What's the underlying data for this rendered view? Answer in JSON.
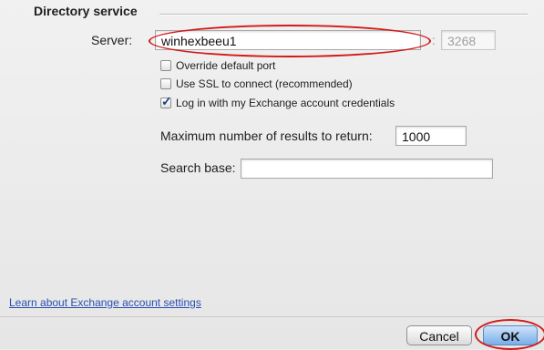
{
  "section": {
    "title": "Directory service"
  },
  "server": {
    "label": "Server:",
    "value": "winhexbeeu1",
    "port_value": "3268",
    "port_separator": ":"
  },
  "checkboxes": [
    {
      "label": "Override default port",
      "checked": false
    },
    {
      "label": "Use SSL to connect (recommended)",
      "checked": false
    },
    {
      "label": "Log in with my Exchange account credentials",
      "checked": true
    }
  ],
  "max_results": {
    "label": "Maximum number of results to return:",
    "value": "1000"
  },
  "search_base": {
    "label": "Search base:",
    "value": ""
  },
  "footer": {
    "link": "Learn about Exchange account settings",
    "cancel": "Cancel",
    "ok": "OK"
  },
  "colors": {
    "highlight_circle": "#d21a1a",
    "link": "#2a4fb2",
    "default_button": "#78aee8"
  }
}
